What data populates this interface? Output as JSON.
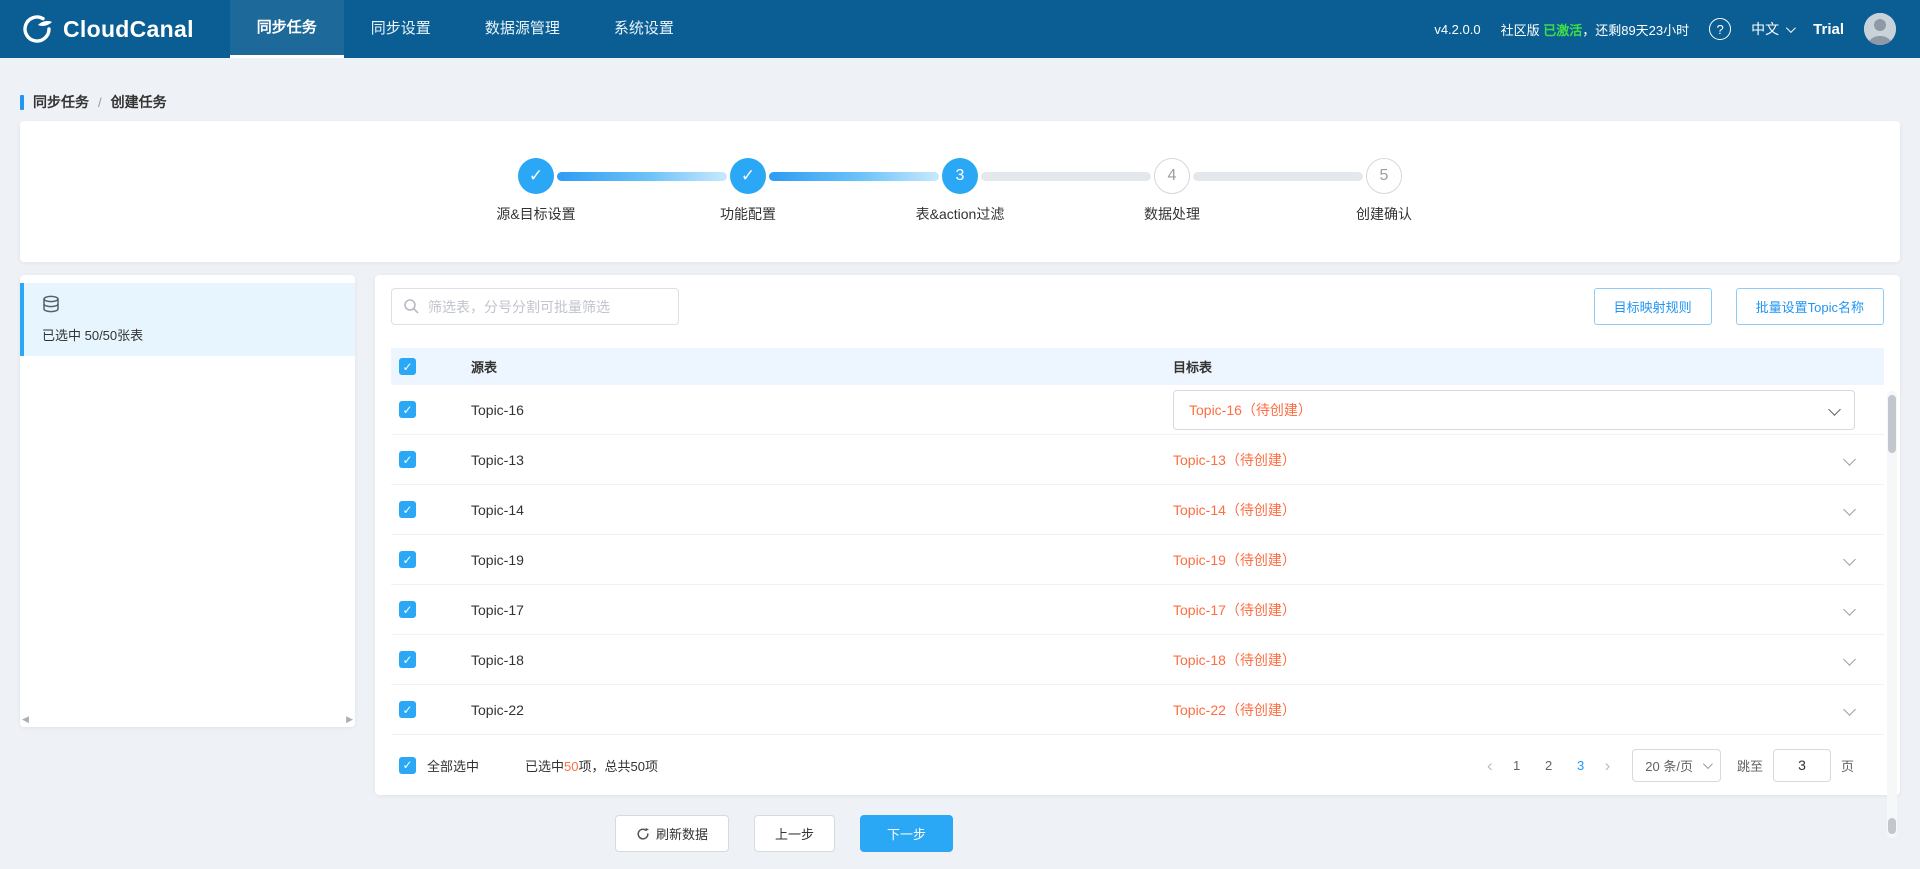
{
  "colors": {
    "navbar_bg": "#0b5e93",
    "primary_blue": "#2aa7f5",
    "link_blue": "#2196f3",
    "accent_orange": "#ff6e42",
    "activated_green": "#3fdc4a"
  },
  "navbar": {
    "brand": "CloudCanal",
    "items": [
      {
        "label": "同步任务"
      },
      {
        "label": "同步设置"
      },
      {
        "label": "数据源管理"
      },
      {
        "label": "系统设置"
      }
    ],
    "version": "v4.2.0.0",
    "edition_label": "社区版 ",
    "edition_status": "已激活",
    "remaining_text": "，还剩89天23小时",
    "language": "中文",
    "plan": "Trial"
  },
  "breadcrumb": {
    "section": "同步任务",
    "separator": "/",
    "current": "创建任务"
  },
  "steps": [
    {
      "label": "源&目标设置",
      "state": "done"
    },
    {
      "label": "功能配置",
      "state": "done"
    },
    {
      "number": "3",
      "label": "表&action过滤",
      "state": "active"
    },
    {
      "number": "4",
      "label": "数据处理",
      "state": "pending"
    },
    {
      "number": "5",
      "label": "创建确认",
      "state": "pending"
    }
  ],
  "sidebar": {
    "selected_summary": "已选中 50/50张表"
  },
  "toolbar": {
    "search_placeholder": "筛选表，分号分割可批量筛选",
    "mapping_button": "目标映射规则",
    "batch_topic_button": "批量设置Topic名称"
  },
  "table": {
    "col_source": "源表",
    "col_target": "目标表",
    "rows": [
      {
        "source": "Topic-16",
        "target": "Topic-16（待创建）"
      },
      {
        "source": "Topic-13",
        "target": "Topic-13（待创建）"
      },
      {
        "source": "Topic-14",
        "target": "Topic-14（待创建）"
      },
      {
        "source": "Topic-19",
        "target": "Topic-19（待创建）"
      },
      {
        "source": "Topic-17",
        "target": "Topic-17（待创建）"
      },
      {
        "source": "Topic-18",
        "target": "Topic-18（待创建）"
      },
      {
        "source": "Topic-22",
        "target": "Topic-22（待创建）"
      }
    ]
  },
  "footer": {
    "select_all_label": "全部选中",
    "selected_prefix": "已选中",
    "selected_count": "50",
    "selected_mid": "项，总共",
    "total_count": "50",
    "selected_suffix": "项",
    "pages": [
      "1",
      "2",
      "3"
    ],
    "active_page": "3",
    "prev_arrow": "‹",
    "next_arrow": "›",
    "page_size": "20 条/页",
    "jump_label": "跳至",
    "jump_value": "3",
    "jump_unit": "页"
  },
  "actions": {
    "refresh": "刷新数据",
    "previous": "上一步",
    "next": "下一步"
  }
}
